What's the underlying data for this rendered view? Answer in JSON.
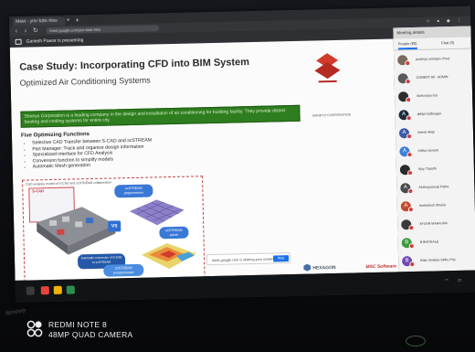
{
  "browser": {
    "tab_title": "Meet - ymr-fdsk-hbw",
    "tab_close": "×",
    "new_tab": "+",
    "url": "meet.google.com/ymr-fdsk-hbw"
  },
  "meet": {
    "presenter_text": "Ganesh Pawar is presenting"
  },
  "slide": {
    "title": "Case Study: Incorporating CFD into BIM System",
    "subtitle": "Optimized Air Conditioning Systems",
    "green_text": "Shinryo Corporation is a leading company in the design and installation of air conditioning for building facility. They provide district heating and cooling systems for entire city.",
    "company_caption": "SHINRYO CORPORATION",
    "functions_heading": "Five Optimizing Functions",
    "bullets": [
      "Selective CAD Transfer between S-CAD and scSTREAM",
      "Part Manager: Track and organize design information",
      "Specialized interface for CFD Analysis",
      "Conversion function to simplify models",
      "Automatic Mesh generation"
    ],
    "diagram": {
      "caption": "CAD analysis model of S-CAD and scSTREAM collaboration",
      "scad_label": "S-CAD",
      "vs_label": "VS",
      "pre_label": "scSTREAM preprocessor",
      "solver_label": "scSTREAM solver",
      "post_label": "scSTREAM postprocessor",
      "note_label": "Automatic conversion of S-CAD to scSTREAM"
    },
    "share_text": "meet.google.com is sharing your screen.",
    "stop_label": "Stop sharing",
    "hexagon_label": "HEXAGON",
    "msc_label": "MSC Software"
  },
  "panel": {
    "header": "Meeting details",
    "people_tab": "People (80)",
    "chat_tab": "Chat (0)",
    "participants": [
      {
        "name": "pradnya waingan (You)",
        "initial": "",
        "color": "#7b6a5a"
      },
      {
        "name": "ZOMBOT 80 - ADMIN",
        "initial": "",
        "color": "#5a5a5a"
      },
      {
        "name": "Aishwarya Gai",
        "initial": "",
        "color": "#2d2d2d"
      },
      {
        "name": "abhijit halbeagar",
        "initial": "A",
        "color": "#1d2a3a"
      },
      {
        "name": "Adesh Mirje",
        "initial": "A",
        "color": "#3b5aa8"
      },
      {
        "name": "Aditya sawant",
        "initial": "A",
        "color": "#3d7fd9"
      },
      {
        "name": "Ajay Tripathi",
        "initial": "",
        "color": "#2a2a2a"
      },
      {
        "name": "Akshayaanugi Patha",
        "initial": "A",
        "color": "#4a4a4a"
      },
      {
        "name": "Ambadash Shukla",
        "initial": "A",
        "color": "#c14a2d"
      },
      {
        "name": "AYUSH MAHAJAN",
        "initial": "",
        "color": "#3a3a3a"
      },
      {
        "name": "B BHOSALE",
        "initial": "B",
        "color": "#3e9a3e"
      },
      {
        "name": "Bala Venkata Sidhu Priy",
        "initial": "B",
        "color": "#6c4ab5"
      }
    ]
  },
  "camera": {
    "model": "REDMI NOTE 8",
    "camera_text": "48MP QUAD CAMERA"
  },
  "laptop_brand": "lenovo"
}
